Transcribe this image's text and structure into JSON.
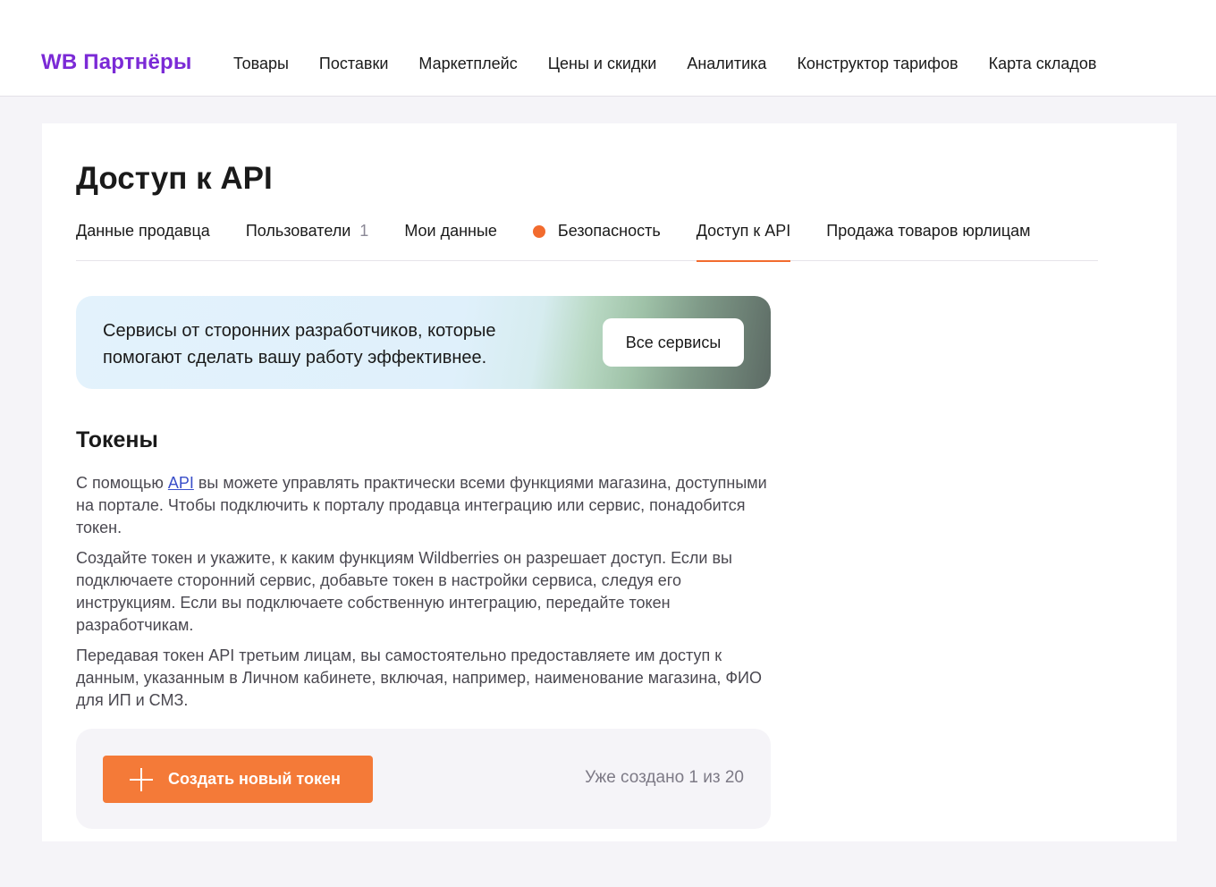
{
  "header": {
    "logo": "WB Партнёры",
    "nav": [
      {
        "label": "Товары"
      },
      {
        "label": "Поставки"
      },
      {
        "label": "Маркетплейс"
      },
      {
        "label": "Цены и скидки"
      },
      {
        "label": "Аналитика"
      },
      {
        "label": "Конструктор тарифов"
      },
      {
        "label": "Карта складов"
      }
    ]
  },
  "page": {
    "title": "Доступ к API",
    "tabs": [
      {
        "label": "Данные продавца"
      },
      {
        "label": "Пользователи",
        "count": "1"
      },
      {
        "label": "Мои данные"
      },
      {
        "label": "Безопасность",
        "indicator": "#f26b2e"
      },
      {
        "label": "Доступ к API",
        "active": true
      },
      {
        "label": "Продажа товаров юрлицам"
      }
    ]
  },
  "banner": {
    "text": "Сервисы от сторонних разработчиков, которые помогают сделать вашу работу эффективнее.",
    "button": "Все сервисы"
  },
  "tokens": {
    "title": "Токены",
    "p1_before": "С помощью ",
    "p1_link": "API",
    "p1_after": " вы можете управлять практически всеми функциями магазина, доступными на портале. Чтобы подключить к порталу продавца интеграцию или сервис, понадобится токен.",
    "p2": "Создайте токен и укажите, к каким функциям Wildberries он разрешает доступ. Если вы подключаете сторонний сервис, добавьте токен в настройки сервиса, следуя его инструкциям. Если вы подключаете собственную интеграцию, передайте токен разработчикам.",
    "p3": "Передавая токен API третьим лицам, вы самостоятельно предоставляете им доступ к данным, указанным в Личном кабинете, включая, например, наименование магазина, ФИО для ИП и СМЗ.",
    "create_button": "Создать новый токен",
    "created_count": "Уже создано 1 из 20"
  },
  "colors": {
    "brand": "#7b2ad6",
    "accent": "#f47a38",
    "link": "#3a4fc9"
  }
}
